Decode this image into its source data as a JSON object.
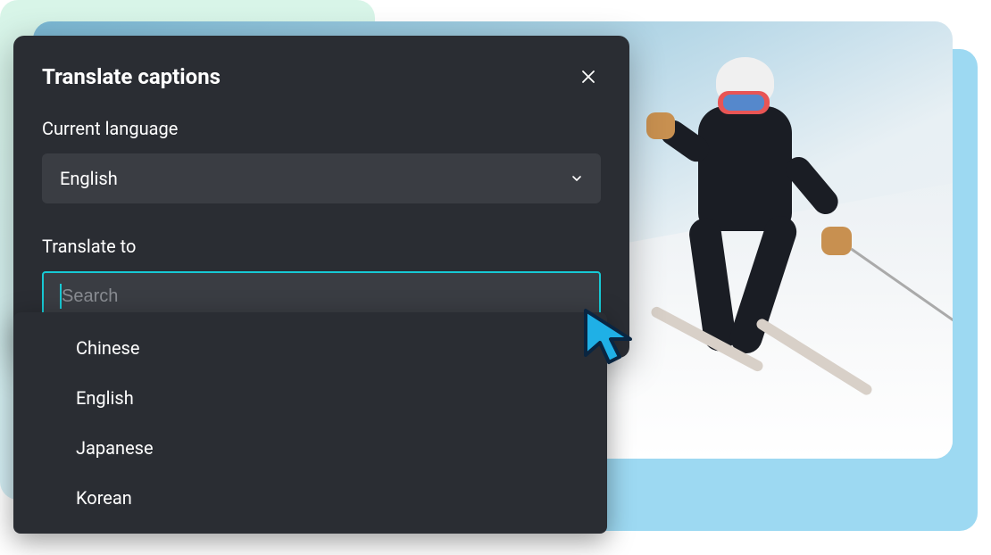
{
  "modal": {
    "title": "Translate captions",
    "currentLanguageLabel": "Current language",
    "currentLanguageValue": "English",
    "translateToLabel": "Translate to",
    "searchPlaceholder": "Search"
  },
  "languageOptions": [
    "Chinese",
    "English",
    "Japanese",
    "Korean"
  ],
  "colors": {
    "accent": "#17c9d4",
    "modalBg": "#2a2d33",
    "inputBg": "#3a3d43"
  }
}
